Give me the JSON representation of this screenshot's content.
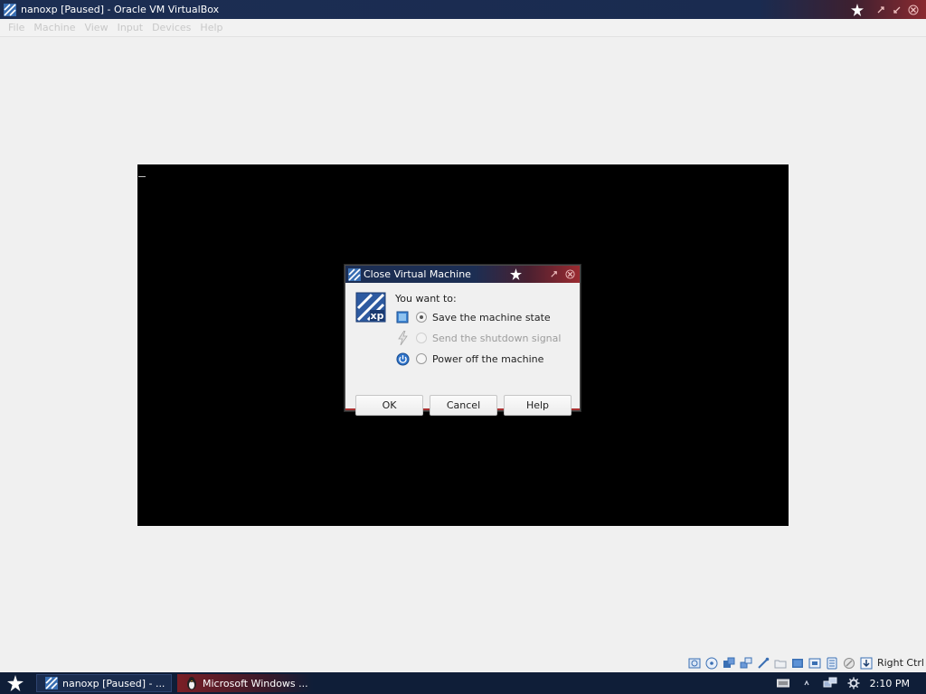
{
  "window": {
    "title": "nanoxp [Paused] - Oracle VM VirtualBox",
    "menu": [
      "File",
      "Machine",
      "View",
      "Input",
      "Devices",
      "Help"
    ]
  },
  "dialog": {
    "title": "Close Virtual Machine",
    "prompt": "You want to:",
    "options": [
      {
        "label": "Save the machine state",
        "checked": true,
        "enabled": true
      },
      {
        "label": "Send the shutdown signal",
        "checked": false,
        "enabled": false
      },
      {
        "label": "Power off the machine",
        "checked": false,
        "enabled": true
      }
    ],
    "buttons": {
      "ok": "OK",
      "cancel": "Cancel",
      "help": "Help"
    },
    "logo_text": "xp"
  },
  "statusbar": {
    "icons": [
      "hard-disk-icon",
      "optical-drive-icon",
      "audio-icon",
      "network-icon",
      "usb-icon",
      "shared-folders-icon",
      "display-icon",
      "video-capture-icon",
      "vrde-icon",
      "mouse-integration-icon",
      "arrow-down-icon"
    ],
    "host_key": "Right Ctrl"
  },
  "taskbar": {
    "tasks": [
      "nanoxp [Paused] - ...",
      "Microsoft Windows ..."
    ],
    "clock": "2:10 PM"
  },
  "colors": {
    "titlebar": "#1c2e53",
    "accent_red": "#a83030",
    "taskbar": "#0f1e38"
  }
}
